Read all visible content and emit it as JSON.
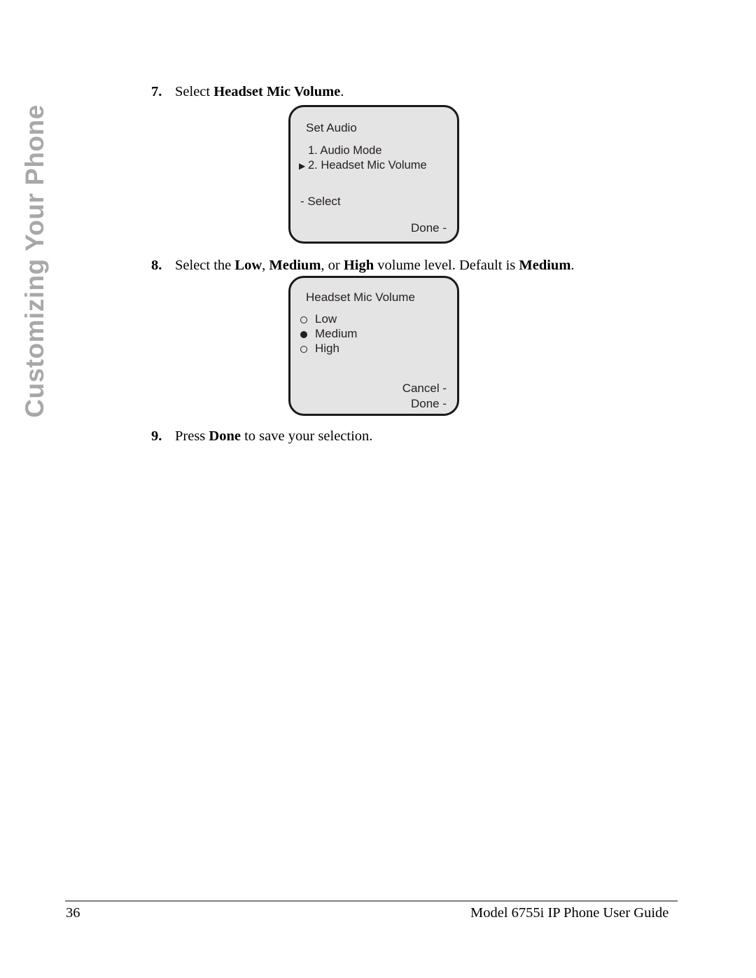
{
  "chapter_tab": {
    "label": "Customizing Your Phone"
  },
  "steps": [
    {
      "number": "7.",
      "parts": [
        "Select ",
        "Headset Mic Volume",
        "."
      ]
    },
    {
      "number": "8.",
      "parts": [
        "Select the ",
        "Low",
        ", ",
        "Medium",
        ", or ",
        "High",
        " volume level. Default is ",
        "Medium",
        "."
      ]
    },
    {
      "number": "9.",
      "parts": [
        "Press ",
        "Done",
        " to save your selection."
      ]
    }
  ],
  "screens": {
    "set_audio": {
      "title": "Set Audio",
      "items": [
        {
          "marker": "",
          "label": "1. Audio Mode"
        },
        {
          "marker": "▶",
          "label": "2. Headset Mic Volume"
        }
      ],
      "softkeys": {
        "left": "- Select",
        "right": "Done -"
      }
    },
    "headset_mic_volume": {
      "title": "Headset Mic Volume",
      "options": [
        {
          "label": "Low",
          "selected": false
        },
        {
          "label": "Medium",
          "selected": true
        },
        {
          "label": "High",
          "selected": false
        }
      ],
      "softkeys": {
        "cancel": "Cancel -",
        "done": "Done -"
      }
    }
  },
  "footer": {
    "page_number": "36",
    "document_title": "Model 6755i IP Phone User Guide"
  }
}
